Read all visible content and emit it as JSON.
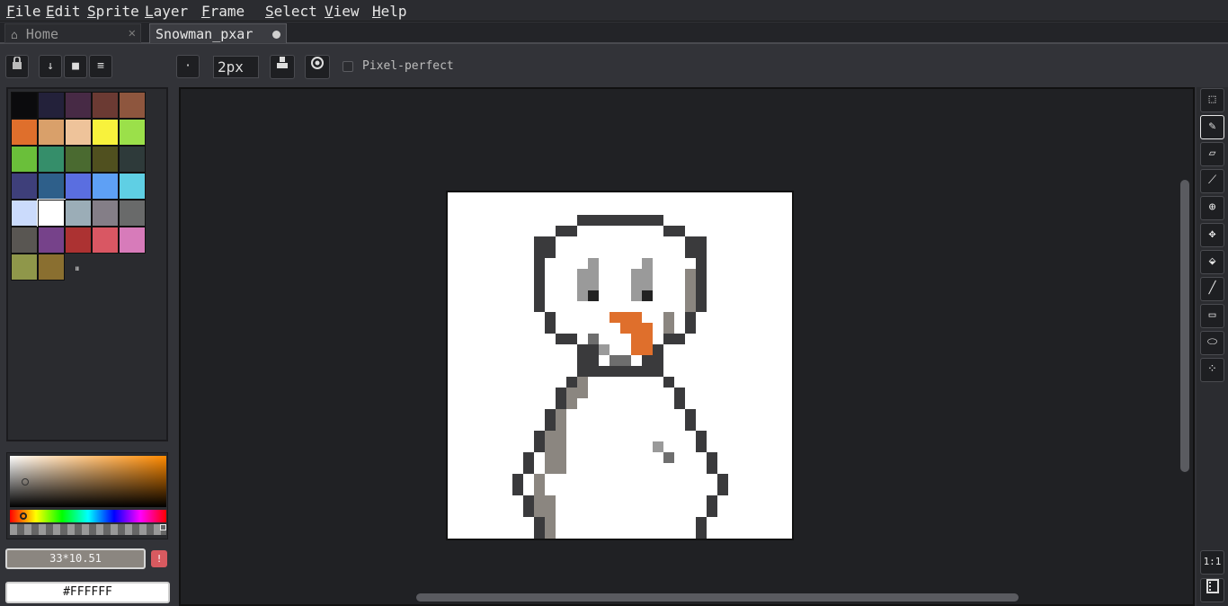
{
  "menu": {
    "file": "File",
    "edit": "Edit",
    "sprite": "Sprite",
    "layer": "Layer",
    "frame": "Frame",
    "select": "Select",
    "view": "View",
    "help": "Help"
  },
  "tabs": {
    "home_label": "Home",
    "home_icon": "house-icon",
    "close_glyph": "✕",
    "file_label": "Snowman_pxar",
    "file_modified": true
  },
  "toolbar": {
    "brush_size_value": "2px",
    "pixel_perfect_label": "Pixel-perfect",
    "pixel_perfect_checked": false,
    "icons": [
      "lock-icon",
      "arrow-down-icon",
      "square-icon",
      "menu-icon",
      "dot-brush-icon",
      "ink-icon",
      "target-icon"
    ]
  },
  "palette": {
    "colors": [
      "#0b0b0d",
      "#23213a",
      "#472a45",
      "#6b3a33",
      "#8e563e",
      "#df6f2c",
      "#d9a06a",
      "#eec39a",
      "#f8f23c",
      "#9be04a",
      "#6abf3a",
      "#358e6a",
      "#4a6a30",
      "#50501f",
      "#2e3a3a",
      "#3e3f7a",
      "#2e5f8a",
      "#5a6ee0",
      "#5ea0f5",
      "#5fcfe4",
      "#cbdbfc",
      "#ffffff",
      "#9badb7",
      "#847e87",
      "#696a6a",
      "#595652",
      "#76428a",
      "#ac3232",
      "#d95763",
      "#d77bba",
      "#8f974a",
      "#8a6f30"
    ],
    "selected_index": 21,
    "handle": "⏸"
  },
  "color_picker": {
    "coords_text": "33*10.51",
    "info_icon": "!",
    "hex_value": "#FFFFFF"
  },
  "tools": [
    {
      "name": "rectangle-select-icon",
      "glyph": "⬚"
    },
    {
      "name": "pencil-icon",
      "glyph": "✎"
    },
    {
      "name": "eraser-icon",
      "glyph": "▱"
    },
    {
      "name": "eyedropper-icon",
      "glyph": "⟋"
    },
    {
      "name": "zoom-icon",
      "glyph": "⊕"
    },
    {
      "name": "move-icon",
      "glyph": "✥"
    },
    {
      "name": "bucket-icon",
      "glyph": "⬙"
    },
    {
      "name": "line-icon",
      "glyph": "╱"
    },
    {
      "name": "rectangle-icon",
      "glyph": "▭"
    },
    {
      "name": "ellipse-icon",
      "glyph": "⬭"
    },
    {
      "name": "spray-icon",
      "glyph": "⁘"
    }
  ],
  "bottom_tools": {
    "actual_size_label": "1:1",
    "timeline_icon": "film-icon"
  },
  "colors": {
    "outline": "#3a3a3c",
    "shadow": "#8b8680",
    "carrot": "#df6f2c",
    "eye_grey": "#9a9a9a",
    "mid_grey": "#6e6e6e",
    "background": "#ffffff"
  }
}
